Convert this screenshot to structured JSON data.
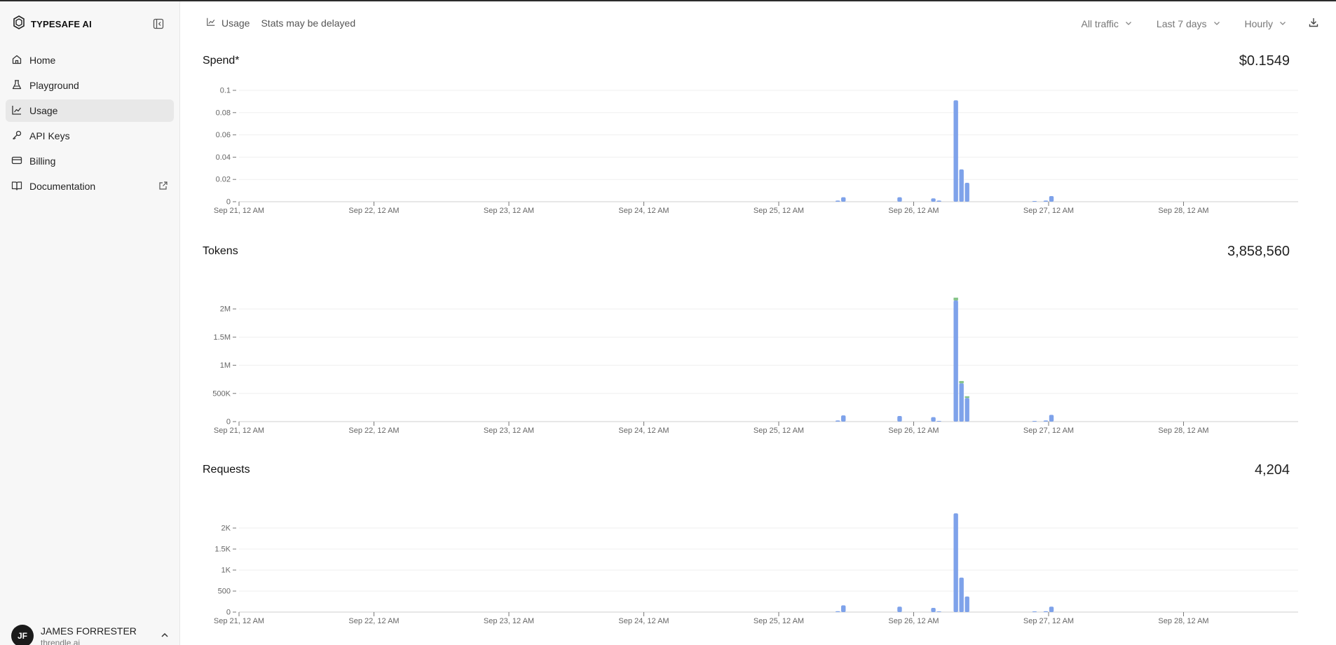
{
  "app": {
    "brand": "TYPESAFE AI"
  },
  "sidebar": {
    "items": [
      {
        "label": "Home",
        "icon": "home-icon"
      },
      {
        "label": "Playground",
        "icon": "flask-icon"
      },
      {
        "label": "Usage",
        "icon": "chart-line-icon",
        "active": true
      },
      {
        "label": "API Keys",
        "icon": "key-icon"
      },
      {
        "label": "Billing",
        "icon": "card-icon"
      },
      {
        "label": "Documentation",
        "icon": "book-icon",
        "external": true
      }
    ],
    "user": {
      "initials": "JF",
      "name": "JAMES FORRESTER",
      "org": "threndle.ai"
    }
  },
  "header": {
    "title": "Usage",
    "note": "Stats may be delayed",
    "filters": {
      "traffic": "All traffic",
      "range": "Last 7 days",
      "granularity": "Hourly"
    }
  },
  "colors": {
    "bar": "#7ea2ea",
    "bar_secondary": "#86c48a",
    "grid": "#efefef",
    "axis": "#cfcfcf",
    "tick": "#666666"
  },
  "chart_data": [
    {
      "type": "bar",
      "title": "Spend*",
      "total": "$0.1549",
      "x_tick_labels": [
        "Sep 21, 12 AM",
        "Sep 22, 12 AM",
        "Sep 23, 12 AM",
        "Sep 24, 12 AM",
        "Sep 25, 12 AM",
        "Sep 26, 12 AM",
        "Sep 27, 12 AM",
        "Sep 28, 12 AM"
      ],
      "x_range_hours": [
        0,
        155
      ],
      "y_ticks": [
        0,
        0.02,
        0.04,
        0.06,
        0.08,
        0.1
      ],
      "y_tick_labels": [
        "0",
        "0.02",
        "0.04",
        "0.06",
        "0.08",
        "0.1"
      ],
      "ylim": [
        0,
        0.1
      ],
      "series": [
        {
          "hours": [
            106,
            107,
            117,
            123,
            124,
            127,
            128,
            129,
            141,
            143,
            144
          ],
          "values": [
            0.001,
            0.004,
            0.004,
            0.003,
            0.001,
            0.091,
            0.029,
            0.017,
            0.0005,
            0.001,
            0.005
          ]
        }
      ]
    },
    {
      "type": "bar",
      "title": "Tokens",
      "total": "3,858,560",
      "x_tick_labels": [
        "Sep 21, 12 AM",
        "Sep 22, 12 AM",
        "Sep 23, 12 AM",
        "Sep 24, 12 AM",
        "Sep 25, 12 AM",
        "Sep 26, 12 AM",
        "Sep 27, 12 AM",
        "Sep 28, 12 AM"
      ],
      "x_range_hours": [
        0,
        155
      ],
      "y_ticks": [
        0,
        500000,
        1000000,
        1500000,
        2000000
      ],
      "y_tick_labels": [
        "0",
        "500K",
        "1M",
        "1.5M",
        "2M"
      ],
      "ylim": [
        0,
        2200000
      ],
      "series": [
        {
          "hours": [
            106,
            107,
            117,
            123,
            124,
            127,
            128,
            129,
            141,
            143,
            144
          ],
          "values": [
            20000,
            110000,
            100000,
            80000,
            10000,
            2150000,
            680000,
            420000,
            5000,
            20000,
            120000
          ]
        },
        {
          "hours": [
            127,
            128,
            129
          ],
          "values": [
            50000,
            40000,
            30000
          ]
        }
      ]
    },
    {
      "type": "bar",
      "title": "Requests",
      "total": "4,204",
      "x_tick_labels": [
        "Sep 21, 12 AM",
        "Sep 22, 12 AM",
        "Sep 23, 12 AM",
        "Sep 24, 12 AM",
        "Sep 25, 12 AM",
        "Sep 26, 12 AM",
        "Sep 27, 12 AM",
        "Sep 28, 12 AM"
      ],
      "x_range_hours": [
        0,
        155
      ],
      "y_ticks": [
        0,
        500,
        1000,
        1500,
        2000
      ],
      "y_tick_labels": [
        "0",
        "500",
        "1K",
        "1.5K",
        "2K"
      ],
      "ylim": [
        0,
        2400
      ],
      "series": [
        {
          "hours": [
            106,
            107,
            117,
            123,
            124,
            127,
            128,
            129,
            141,
            143,
            144
          ],
          "values": [
            20,
            160,
            130,
            100,
            10,
            2350,
            820,
            370,
            5,
            20,
            130
          ]
        }
      ]
    }
  ]
}
